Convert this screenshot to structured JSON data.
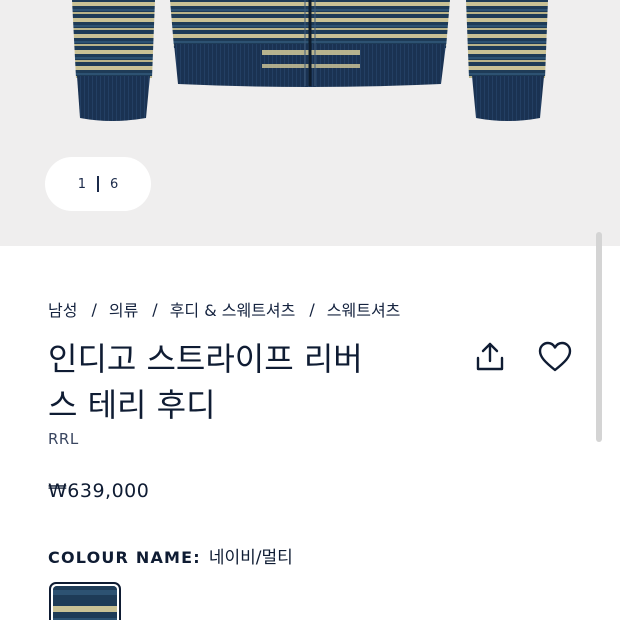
{
  "gallery": {
    "current_index": "1",
    "total_count": "6"
  },
  "breadcrumb": {
    "items": [
      "남성",
      "의류",
      "후디 & 스웨트셔츠",
      "스웨트셔츠"
    ],
    "separator": "/"
  },
  "product": {
    "title_line1": "인디고 스트라이프 리버",
    "title_line2": "스 테리 후디",
    "brand": "RRL",
    "price": "₩639,000"
  },
  "colour": {
    "label": "COLOUR NAME:",
    "value": "네이비/멀티",
    "swatch_colors": [
      "#1e3b57",
      "#c9c195",
      "#2d5272"
    ]
  },
  "icons": {
    "share": "share-icon",
    "wishlist": "heart-icon"
  },
  "colors": {
    "navy": "#0f1c33",
    "gallery_bg": "#efeeee",
    "stripe_tan": "#c9c195",
    "knit_navy": "#1e3b57"
  }
}
